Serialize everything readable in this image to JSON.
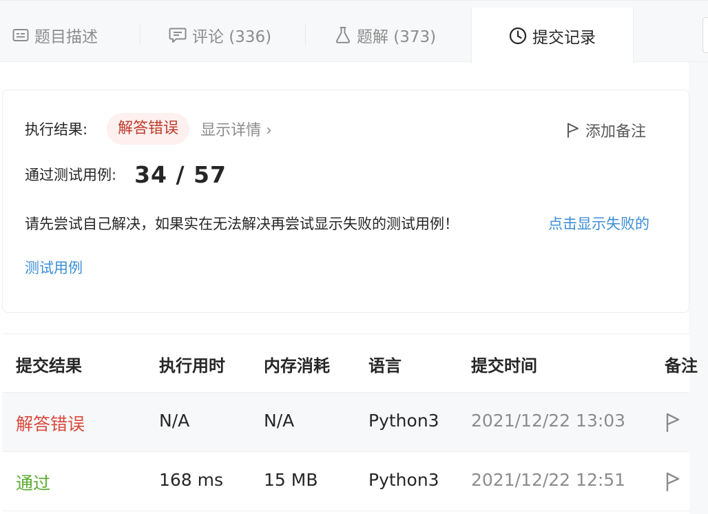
{
  "tabs": [
    {
      "label": "题目描述",
      "icon": "description-icon"
    },
    {
      "label": "评论 (336)",
      "icon": "comment-icon"
    },
    {
      "label": "题解 (373)",
      "icon": "flask-icon"
    },
    {
      "label": "提交记录",
      "icon": "clock-icon",
      "active": true
    }
  ],
  "result": {
    "status_label": "执行结果:",
    "status_value": "解答错误",
    "details_link": "显示详情 ›",
    "add_note": "添加备注",
    "passed_label": "通过测试用例:",
    "passed_value": "34 / 57",
    "hint_text": "请先尝试自己解决，如果实在无法解决再尝试显示失败的测试用例！",
    "hint_link_part1": "点击显示失败的",
    "hint_link_part2": "测试用例"
  },
  "table": {
    "headers": [
      "提交结果",
      "执行用时",
      "内存消耗",
      "语言",
      "提交时间",
      "备注"
    ],
    "rows": [
      {
        "result": "解答错误",
        "runtime": "N/A",
        "memory": "N/A",
        "language": "Python3",
        "time": "2021/12/22 13:03"
      },
      {
        "result": "通过",
        "runtime": "168 ms",
        "memory": "15 MB",
        "language": "Python3",
        "time": "2021/12/22 12:51"
      }
    ]
  },
  "colors": {
    "error_text": "#d9493b",
    "accepted_text": "#5aab2f",
    "link": "#3b8ed8",
    "badge_bg": "#fdf0ee"
  }
}
